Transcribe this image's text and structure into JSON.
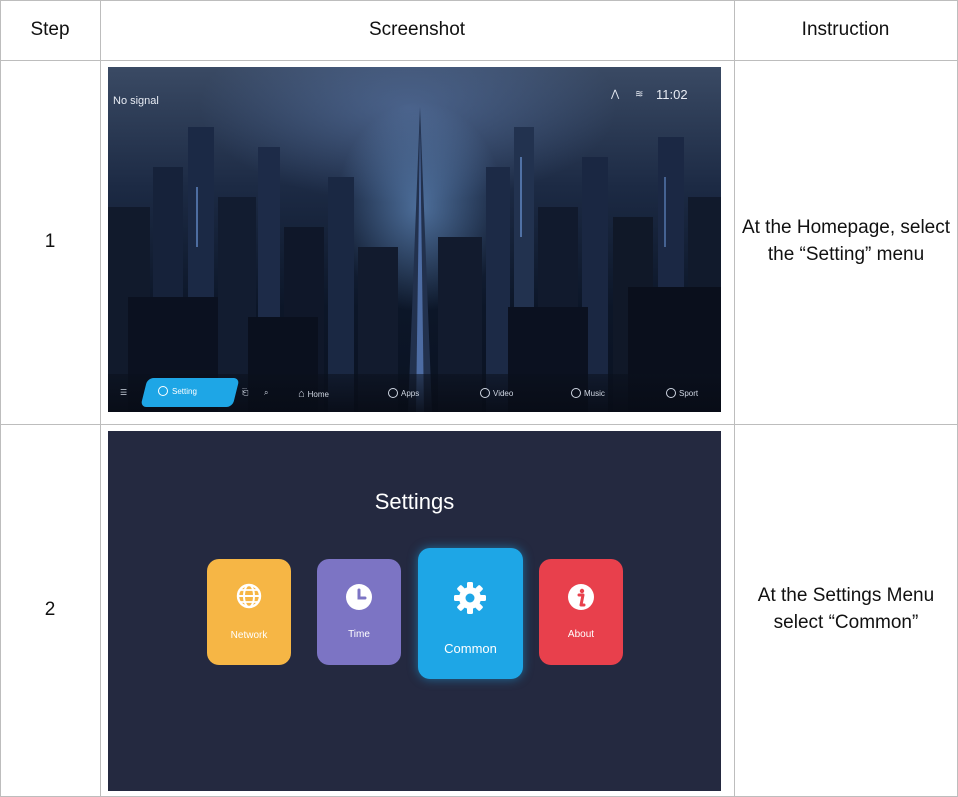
{
  "table": {
    "headers": {
      "step": "Step",
      "screenshot": "Screenshot",
      "instruction": "Instruction"
    },
    "rows": [
      {
        "step": "1",
        "instruction": "At the Homepage, select the “Setting” menu"
      },
      {
        "step": "2",
        "instruction": "At the Settings Menu select “Common”"
      }
    ]
  },
  "homepage": {
    "signal_text": "No signal",
    "clock": "11:02",
    "nav": {
      "setting": "Setting",
      "home": "Home",
      "apps": "Apps",
      "video": "Video",
      "music": "Music",
      "sport": "Sport"
    }
  },
  "settings_screen": {
    "title": "Settings",
    "tiles": [
      {
        "label": "Network",
        "icon": "globe-icon",
        "color": "#f6b645"
      },
      {
        "label": "Time",
        "icon": "clock-icon",
        "color": "#7c74c4"
      },
      {
        "label": "Common",
        "icon": "gear-icon",
        "color": "#1ea6e6",
        "selected": true
      },
      {
        "label": "About",
        "icon": "info-icon",
        "color": "#e8404c"
      }
    ]
  },
  "colors": {
    "grid": "#bdbdbd",
    "settings_bg": "#242940",
    "accent": "#1ea6e6"
  }
}
